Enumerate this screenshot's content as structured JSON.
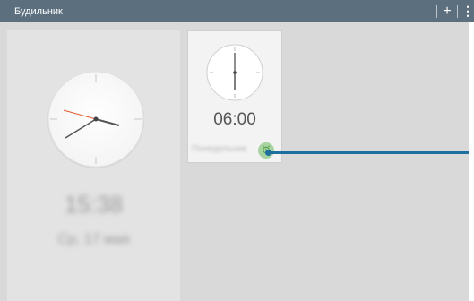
{
  "app": {
    "title": "Будильник"
  },
  "toolbar": {
    "add_icon": "plus-icon",
    "more_icon": "more-vertical-icon"
  },
  "current_time": {
    "time": "15:38",
    "date": "Ср, 17 мая"
  },
  "alarms": [
    {
      "time": "06:00",
      "repeat": "Понедельник",
      "enabled": true,
      "toggle_icon": "alarm-clock-icon"
    }
  ],
  "colors": {
    "titlebar": "#5b6f7f",
    "background": "#d9d9d9",
    "second_hand": "#e2592a",
    "callout": "#1e6e9e",
    "toggle_active": "#a6d3a0"
  }
}
